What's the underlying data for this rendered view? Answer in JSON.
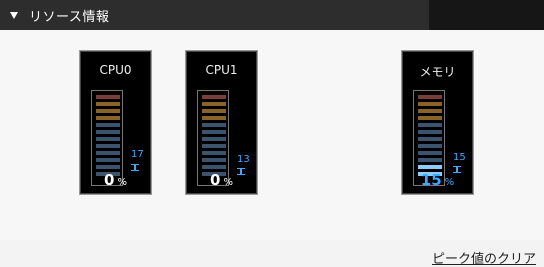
{
  "panel": {
    "title": "リソース情報",
    "collapse_icon": "triangle-down-icon"
  },
  "meters": [
    {
      "id": "cpu0",
      "label": "CPU0",
      "percent": "0",
      "unit": "%",
      "peak": "17",
      "usage_fraction": 0.0
    },
    {
      "id": "cpu1",
      "label": "CPU1",
      "percent": "0",
      "unit": "%",
      "peak": "13",
      "usage_fraction": 0.0
    },
    {
      "id": "memory",
      "label": "メモリ",
      "percent": "15",
      "unit": "%",
      "peak": "15",
      "usage_fraction": 0.15
    }
  ],
  "colors": {
    "header_bg": "#2d2d2d",
    "segment_high": "#7a3e36",
    "segment_mid": "#8a6329",
    "segment_low": "#3b536c",
    "segment_active": "#8ecbff",
    "peak": "#42a7ff",
    "percent_active": "#39a9ff"
  },
  "actions": {
    "clear_peak_label": "ピーク値のクリア"
  }
}
